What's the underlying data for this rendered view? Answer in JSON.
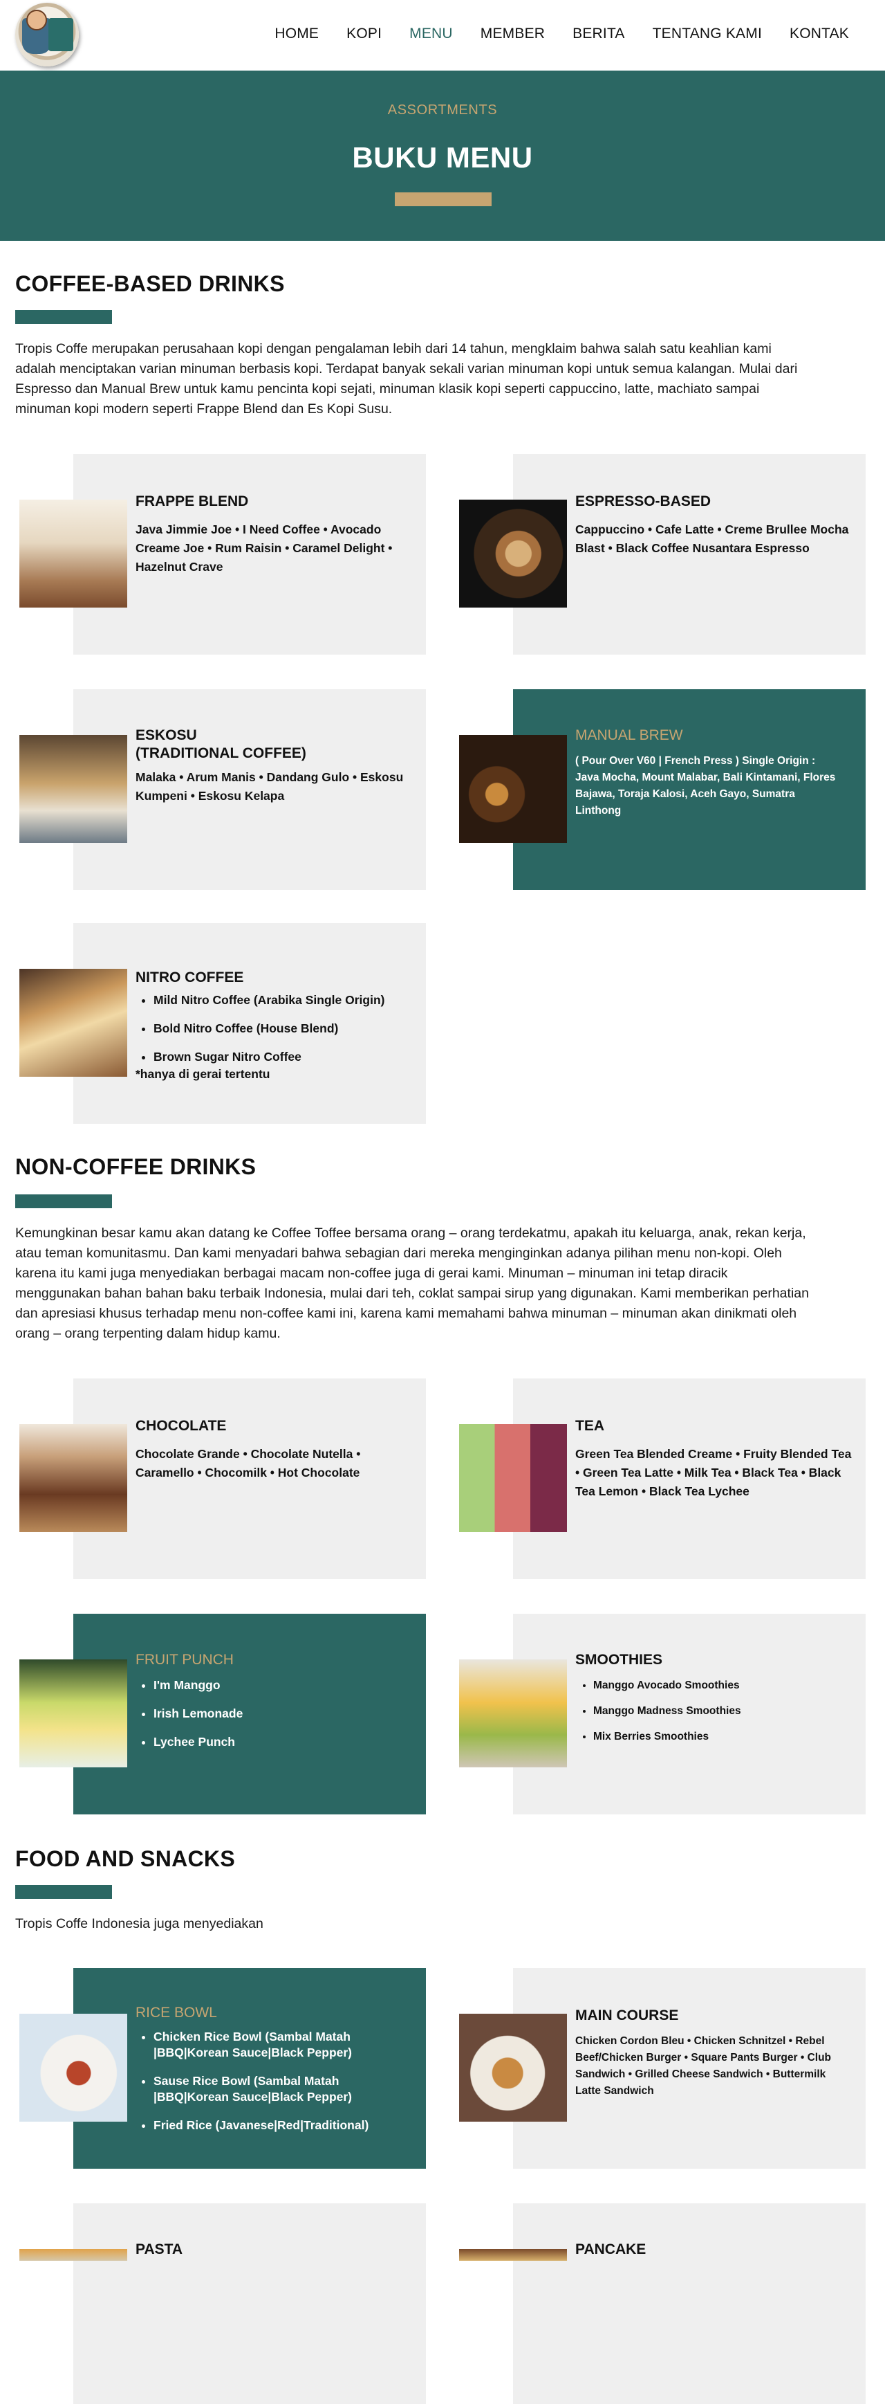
{
  "header": {
    "nav": [
      "HOME",
      "KOPI",
      "MENU",
      "MEMBER",
      "BERITA",
      "TENTANG KAMI",
      "KONTAK"
    ],
    "active_nav": "MENU"
  },
  "hero": {
    "eyebrow": "ASSORTMENTS",
    "title": "BUKU MENU"
  },
  "coffee": {
    "title": "COFFEE-BASED DRINKS",
    "intro": "Tropis Coffe merupakan perusahaan kopi dengan pengalaman lebih dari 14 tahun, mengklaim bahwa salah satu keahlian kami adalah menciptakan varian minuman berbasis kopi. Terdapat banyak sekali varian minuman kopi untuk semua kalangan. Mulai dari Espresso dan Manual Brew untuk kamu pencinta kopi sejati, minuman klasik kopi seperti cappuccino, latte, machiato sampai minuman kopi modern seperti Frappe Blend dan Es Kopi Susu.",
    "cards": {
      "frappe": {
        "title": "FRAPPE BLEND",
        "body": "Java Jimmie Joe • I Need Coffee • Avocado Creame Joe • Rum Raisin • Caramel Delight • Hazelnut Crave"
      },
      "espresso": {
        "title": "ESPRESSO-BASED",
        "body": "Cappuccino • Cafe Latte •  Creme Brullee Mocha Blast • Black Coffee Nusantara Espresso"
      },
      "eskosu": {
        "title_line1": "ESKOSU",
        "title_line2": "(TRADITIONAL COFFEE)",
        "body": "Malaka • Arum Manis • Dandang Gulo • Eskosu Kumpeni  • Eskosu Kelapa"
      },
      "manual": {
        "title": "MANUAL BREW",
        "body": "( Pour Over V60 | French Press ) Single Origin : Java Mocha, Mount Malabar, Bali Kintamani, Flores Bajawa, Toraja Kalosi, Aceh Gayo, Sumatra Linthong"
      },
      "nitro": {
        "title": "NITRO COFFEE",
        "items": [
          "Mild Nitro Coffee (Arabika Single Origin)",
          "Bold Nitro Coffee (House Blend)",
          "Brown Sugar Nitro Coffee"
        ],
        "note": "*hanya di gerai tertentu"
      }
    }
  },
  "noncoffee": {
    "title": "NON-COFFEE DRINKS",
    "intro": "Kemungkinan besar kamu akan datang ke Coffee Toffee bersama orang – orang terdekatmu,  apakah itu keluarga, anak, rekan kerja, atau teman komunitasmu. Dan kami menyadari bahwa sebagian dari mereka menginginkan adanya pilihan menu non-kopi. Oleh karena itu kami juga menyediakan berbagai macam non-coffee juga di gerai  kami. Minuman – minuman ini tetap diracik menggunakan bahan bahan baku terbaik Indonesia, mulai dari teh, coklat sampai sirup yang digunakan. Kami memberikan perhatian dan apresiasi khusus terhadap menu non-coffee kami ini, karena kami memahami bahwa minuman – minuman akan dinikmati oleh orang – orang terpenting dalam hidup kamu.",
    "cards": {
      "chocolate": {
        "title": "CHOCOLATE",
        "body": "Chocolate Grande • Chocolate Nutella • Caramello • Chocomilk • Hot Chocolate"
      },
      "tea": {
        "title": "TEA",
        "body": "Green Tea Blended Creame • Fruity Blended Tea • Green Tea Latte • Milk Tea • Black Tea • Black Tea Lemon • Black Tea Lychee"
      },
      "punch": {
        "title": "FRUIT PUNCH",
        "items": [
          "I'm Manggo",
          "Irish Lemonade",
          "Lychee Punch"
        ]
      },
      "smoothies": {
        "title": "SMOOTHIES",
        "items": [
          "Manggo Avocado Smoothies",
          "Manggo Madness Smoothies",
          "Mix Berries Smoothies"
        ]
      }
    }
  },
  "food": {
    "title": "FOOD AND SNACKS",
    "intro": "Tropis Coffe Indonesia juga menyediakan",
    "cards": {
      "rice": {
        "title": "RICE BOWL",
        "items": [
          "Chicken Rice Bowl (Sambal Matah |BBQ|Korean Sauce|Black Pepper)",
          "Sause Rice Bowl (Sambal Matah |BBQ|Korean Sauce|Black Pepper)",
          "Fried Rice (Javanese|Red|Traditional)"
        ]
      },
      "main": {
        "title": "MAIN COURSE",
        "body": "Chicken Cordon Bleu • Chicken Schnitzel • Rebel Beef/Chicken Burger • Square Pants Burger • Club Sandwich • Grilled Cheese Sandwich • Buttermilk Latte Sandwich"
      },
      "pasta": {
        "title": "PASTA"
      },
      "pancake": {
        "title": "PANCAKE"
      }
    }
  }
}
